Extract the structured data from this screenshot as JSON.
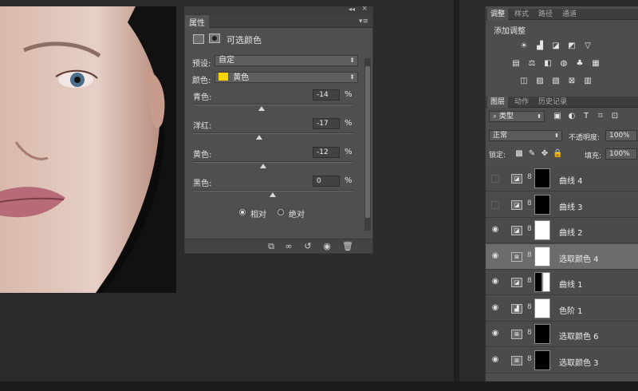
{
  "properties_panel": {
    "tab_label": "属性",
    "header_title": "可选颜色",
    "preset_label": "预设:",
    "preset_value": "自定",
    "color_label": "颜色:",
    "color_value": "黄色",
    "color_swatch": "#f5d400",
    "sliders": [
      {
        "label": "青色:",
        "value": "-14",
        "unit": "%",
        "level": 0.43
      },
      {
        "label": "洋红:",
        "value": "-17",
        "unit": "%",
        "level": 0.415
      },
      {
        "label": "黄色:",
        "value": "-12",
        "unit": "%",
        "level": 0.44
      },
      {
        "label": "黑色:",
        "value": "0",
        "unit": "%",
        "level": 0.5
      }
    ],
    "method_relative": "相对",
    "method_absolute": "绝对",
    "method_selected": "相对"
  },
  "adjustments_panel": {
    "tabs": [
      "调整",
      "样式",
      "路径",
      "通道"
    ],
    "active_tab": "调整",
    "heading": "添加调整"
  },
  "layers_panel": {
    "tabs": [
      "图层",
      "动作",
      "历史记录"
    ],
    "active_tab": "图层",
    "filter_kind": "类型",
    "blend_mode": "正常",
    "opacity_label": "不透明度:",
    "opacity_value": "100%",
    "lock_label": "锁定:",
    "fill_label": "填充:",
    "fill_value": "100%",
    "layers": [
      {
        "name": "曲线 4",
        "visible": false,
        "type": "curves",
        "mask": "dark"
      },
      {
        "name": "曲线 3",
        "visible": false,
        "type": "curves",
        "mask": "dark"
      },
      {
        "name": "曲线 2",
        "visible": true,
        "type": "curves",
        "mask": "white"
      },
      {
        "name": "选取颜色 4",
        "visible": true,
        "type": "selective",
        "mask": "white",
        "selected": true
      },
      {
        "name": "曲线 1",
        "visible": true,
        "type": "curves",
        "mask": "mixed"
      },
      {
        "name": "色阶 1",
        "visible": true,
        "type": "levels",
        "mask": "white"
      },
      {
        "name": "选取颜色 6",
        "visible": true,
        "type": "selective",
        "mask": "dark"
      },
      {
        "name": "选取颜色 3",
        "visible": true,
        "type": "selective",
        "mask": "dark"
      }
    ]
  }
}
